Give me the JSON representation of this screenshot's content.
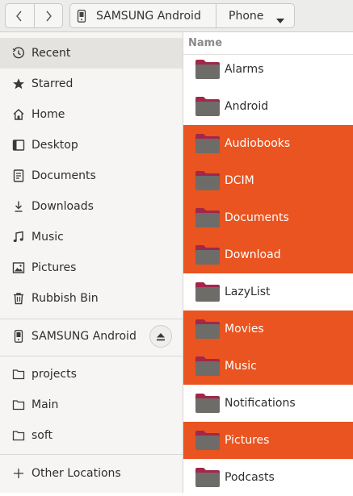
{
  "header": {
    "back_label": "‹",
    "forward_label": "›",
    "device_label": "SAMSUNG Android",
    "location_label": "Phone"
  },
  "sidebar": {
    "places": [
      {
        "label": "Recent",
        "icon": "recent-icon",
        "active": true
      },
      {
        "label": "Starred",
        "icon": "star-icon"
      },
      {
        "label": "Home",
        "icon": "home-icon"
      },
      {
        "label": "Desktop",
        "icon": "desktop-icon"
      },
      {
        "label": "Documents",
        "icon": "documents-icon"
      },
      {
        "label": "Downloads",
        "icon": "downloads-icon"
      },
      {
        "label": "Music",
        "icon": "music-icon"
      },
      {
        "label": "Pictures",
        "icon": "pictures-icon"
      },
      {
        "label": "Rubbish Bin",
        "icon": "trash-icon"
      }
    ],
    "devices": [
      {
        "label": "SAMSUNG Android",
        "icon": "phone-icon"
      }
    ],
    "bookmarks": [
      {
        "label": "projects",
        "icon": "folder-icon"
      },
      {
        "label": "Main",
        "icon": "folder-icon"
      },
      {
        "label": "soft",
        "icon": "folder-icon"
      }
    ],
    "other": {
      "label": "Other Locations",
      "icon": "plus-icon"
    }
  },
  "filelist": {
    "column_header": "Name",
    "rows": [
      {
        "name": "Alarms",
        "selected": false
      },
      {
        "name": "Android",
        "selected": false
      },
      {
        "name": "Audiobooks",
        "selected": true
      },
      {
        "name": "DCIM",
        "selected": true
      },
      {
        "name": "Documents",
        "selected": true
      },
      {
        "name": "Download",
        "selected": true
      },
      {
        "name": "LazyList",
        "selected": false
      },
      {
        "name": "Movies",
        "selected": true
      },
      {
        "name": "Music",
        "selected": true
      },
      {
        "name": "Notifications",
        "selected": false
      },
      {
        "name": "Pictures",
        "selected": true
      },
      {
        "name": "Podcasts",
        "selected": false
      }
    ]
  },
  "colors": {
    "selection": "#e95420",
    "folder_body": "#6d6c69",
    "folder_tab": "#a2274a"
  }
}
